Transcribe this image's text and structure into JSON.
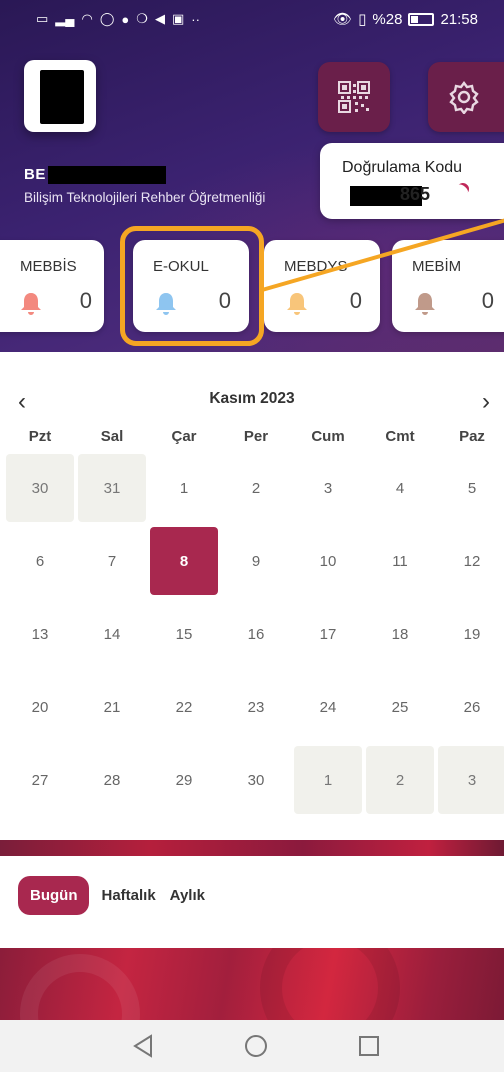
{
  "status_bar": {
    "left_icons": [
      "sim-icon",
      "signal-icon",
      "wifi-icon",
      "whatsapp-icon",
      "app-icon",
      "vodafone-icon",
      "telegram-icon",
      "gallery-icon",
      "more-dots"
    ],
    "battery_text": "%28",
    "time": "21:58"
  },
  "header": {
    "user_initials": "BE",
    "user_title": "Bilişim Teknolojileri Rehber Öğretmenliği",
    "verification": {
      "label": "Doğrulama Kodu",
      "code_suffix": "865"
    }
  },
  "systems": [
    {
      "label": "MEBBİS",
      "count": "0",
      "bell_color": "#f3897f"
    },
    {
      "label": "E-OKUL",
      "count": "0",
      "bell_color": "#8ec5f0"
    },
    {
      "label": "MEBDYS",
      "count": "0",
      "bell_color": "#f8c57a"
    },
    {
      "label": "MEBİM",
      "count": "0",
      "bell_color": "#c09a8a"
    }
  ],
  "calendar": {
    "title": "Kasım 2023",
    "weekdays": [
      "Pzt",
      "Sal",
      "Çar",
      "Per",
      "Cum",
      "Cmt",
      "Paz"
    ],
    "days": [
      {
        "n": "30",
        "t": "other"
      },
      {
        "n": "31",
        "t": "other"
      },
      {
        "n": "1",
        "t": ""
      },
      {
        "n": "2",
        "t": ""
      },
      {
        "n": "3",
        "t": ""
      },
      {
        "n": "4",
        "t": ""
      },
      {
        "n": "5",
        "t": ""
      },
      {
        "n": "6",
        "t": ""
      },
      {
        "n": "7",
        "t": ""
      },
      {
        "n": "8",
        "t": "today"
      },
      {
        "n": "9",
        "t": ""
      },
      {
        "n": "10",
        "t": ""
      },
      {
        "n": "11",
        "t": ""
      },
      {
        "n": "12",
        "t": ""
      },
      {
        "n": "13",
        "t": ""
      },
      {
        "n": "14",
        "t": ""
      },
      {
        "n": "15",
        "t": ""
      },
      {
        "n": "16",
        "t": ""
      },
      {
        "n": "17",
        "t": ""
      },
      {
        "n": "18",
        "t": ""
      },
      {
        "n": "19",
        "t": ""
      },
      {
        "n": "20",
        "t": ""
      },
      {
        "n": "21",
        "t": ""
      },
      {
        "n": "22",
        "t": ""
      },
      {
        "n": "23",
        "t": ""
      },
      {
        "n": "24",
        "t": ""
      },
      {
        "n": "25",
        "t": ""
      },
      {
        "n": "26",
        "t": ""
      },
      {
        "n": "27",
        "t": ""
      },
      {
        "n": "28",
        "t": ""
      },
      {
        "n": "29",
        "t": ""
      },
      {
        "n": "30",
        "t": ""
      },
      {
        "n": "1",
        "t": "other"
      },
      {
        "n": "2",
        "t": "other"
      },
      {
        "n": "3",
        "t": "other"
      }
    ]
  },
  "view_tabs": [
    {
      "label": "Bugün",
      "active": true
    },
    {
      "label": "Haftalık",
      "active": false
    },
    {
      "label": "Aylık",
      "active": false
    }
  ],
  "colors": {
    "accent": "#a8284f",
    "highlight": "#f5a623",
    "header_bg": "#3b2270"
  }
}
